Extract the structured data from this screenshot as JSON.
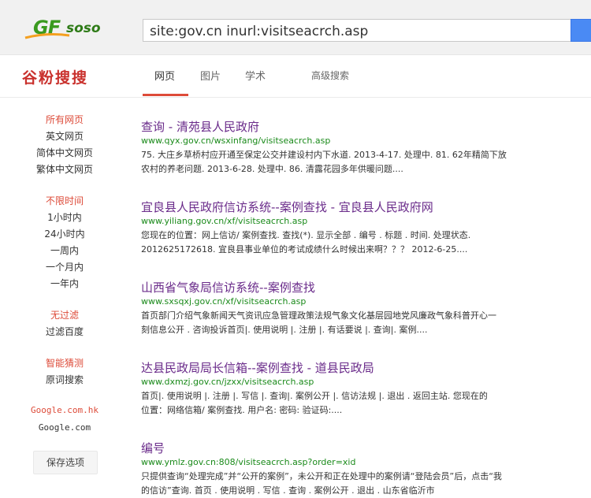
{
  "header": {
    "logo_gf": "GF",
    "logo_soso": "soso",
    "search_value": "site:gov.cn inurl:visitseacrch.asp"
  },
  "nav": {
    "brand": "谷粉搜搜",
    "tabs": [
      "网页",
      "图片",
      "学术",
      "高级搜索"
    ]
  },
  "sidebar": {
    "lang_head": "所有网页",
    "lang_items": [
      "英文网页",
      "简体中文网页",
      "繁体中文网页"
    ],
    "time_head": "不限时间",
    "time_items": [
      "1小时内",
      "24小时内",
      "一周内",
      "一个月内",
      "一年内"
    ],
    "filter_head": "无过滤",
    "filter_item": "过滤百度",
    "guess_head": "智能猜测",
    "guess_item": "原词搜索",
    "domain_head": "Google.com.hk",
    "domain_item": "Google.com",
    "save_label": "保存选项"
  },
  "results": [
    {
      "title": "查询 - 清苑县人民政府",
      "url": "www.qyx.gov.cn/wsxinfang/visitseacrch.asp",
      "snippet1": "75. 大庄乡草桥村应开通至保定公交并建设村内下水道. 2013-4-17. 处理中. 81. 62年精简下放",
      "snippet2": "农村的养老问题. 2013-6-28. 处理中. 86. 清露花园多年供暖问题...."
    },
    {
      "title": "宜良县人民政府信访系统--案例查找 - 宜良县人民政府网",
      "url": "www.yiliang.gov.cn/xf/visitseacrch.asp",
      "snippet1": "您现在的位置：网上信访/ 案例查找. 查找(*). 显示全部 . 编号 . 标题 . 时间. 处理状态.",
      "snippet2": "2012625172618. 宜良县事业单位的考试成绩什么时候出来啊？？？  2012-6-25...."
    },
    {
      "title": "山西省气象局信访系统--案例查找",
      "url": "www.sxsqxj.gov.cn/xf/visitseacrch.asp",
      "snippet1": "首页部门介绍气象新闻天气资讯应急管理政策法规气象文化基层园地党风廉政气象科普开心一",
      "snippet2": "刻信息公开 . 咨询投诉首页|. 使用说明 |. 注册 |. 有话要说 |. 查询|. 案例...."
    },
    {
      "title": "达县民政局局长信箱--案例查找 - 道县民政局",
      "url": "www.dxmzj.gov.cn/jzxx/visitseacrch.asp",
      "snippet1": "首页|. 使用说明 |. 注册 |. 写信 |. 查询|. 案例公开 |. 信访法规 |. 退出 . 返回主站. 您现在的",
      "snippet2": "位置：网络信箱/ 案例查找. 用户名: 密码: 验证码:...."
    },
    {
      "title": "编号",
      "url": "www.ymlz.gov.cn:808/visitseacrch.asp?order=xid",
      "snippet1": "只提供查询“处理完成”并“公开的案例”，未公开和正在处理中的案例请“登陆会员”后，点击“我",
      "snippet2": "的信访”查询. 首页 . 使用说明 . 写信 . 查询 . 案例公开 . 退出 . 山东省临沂市"
    }
  ]
}
